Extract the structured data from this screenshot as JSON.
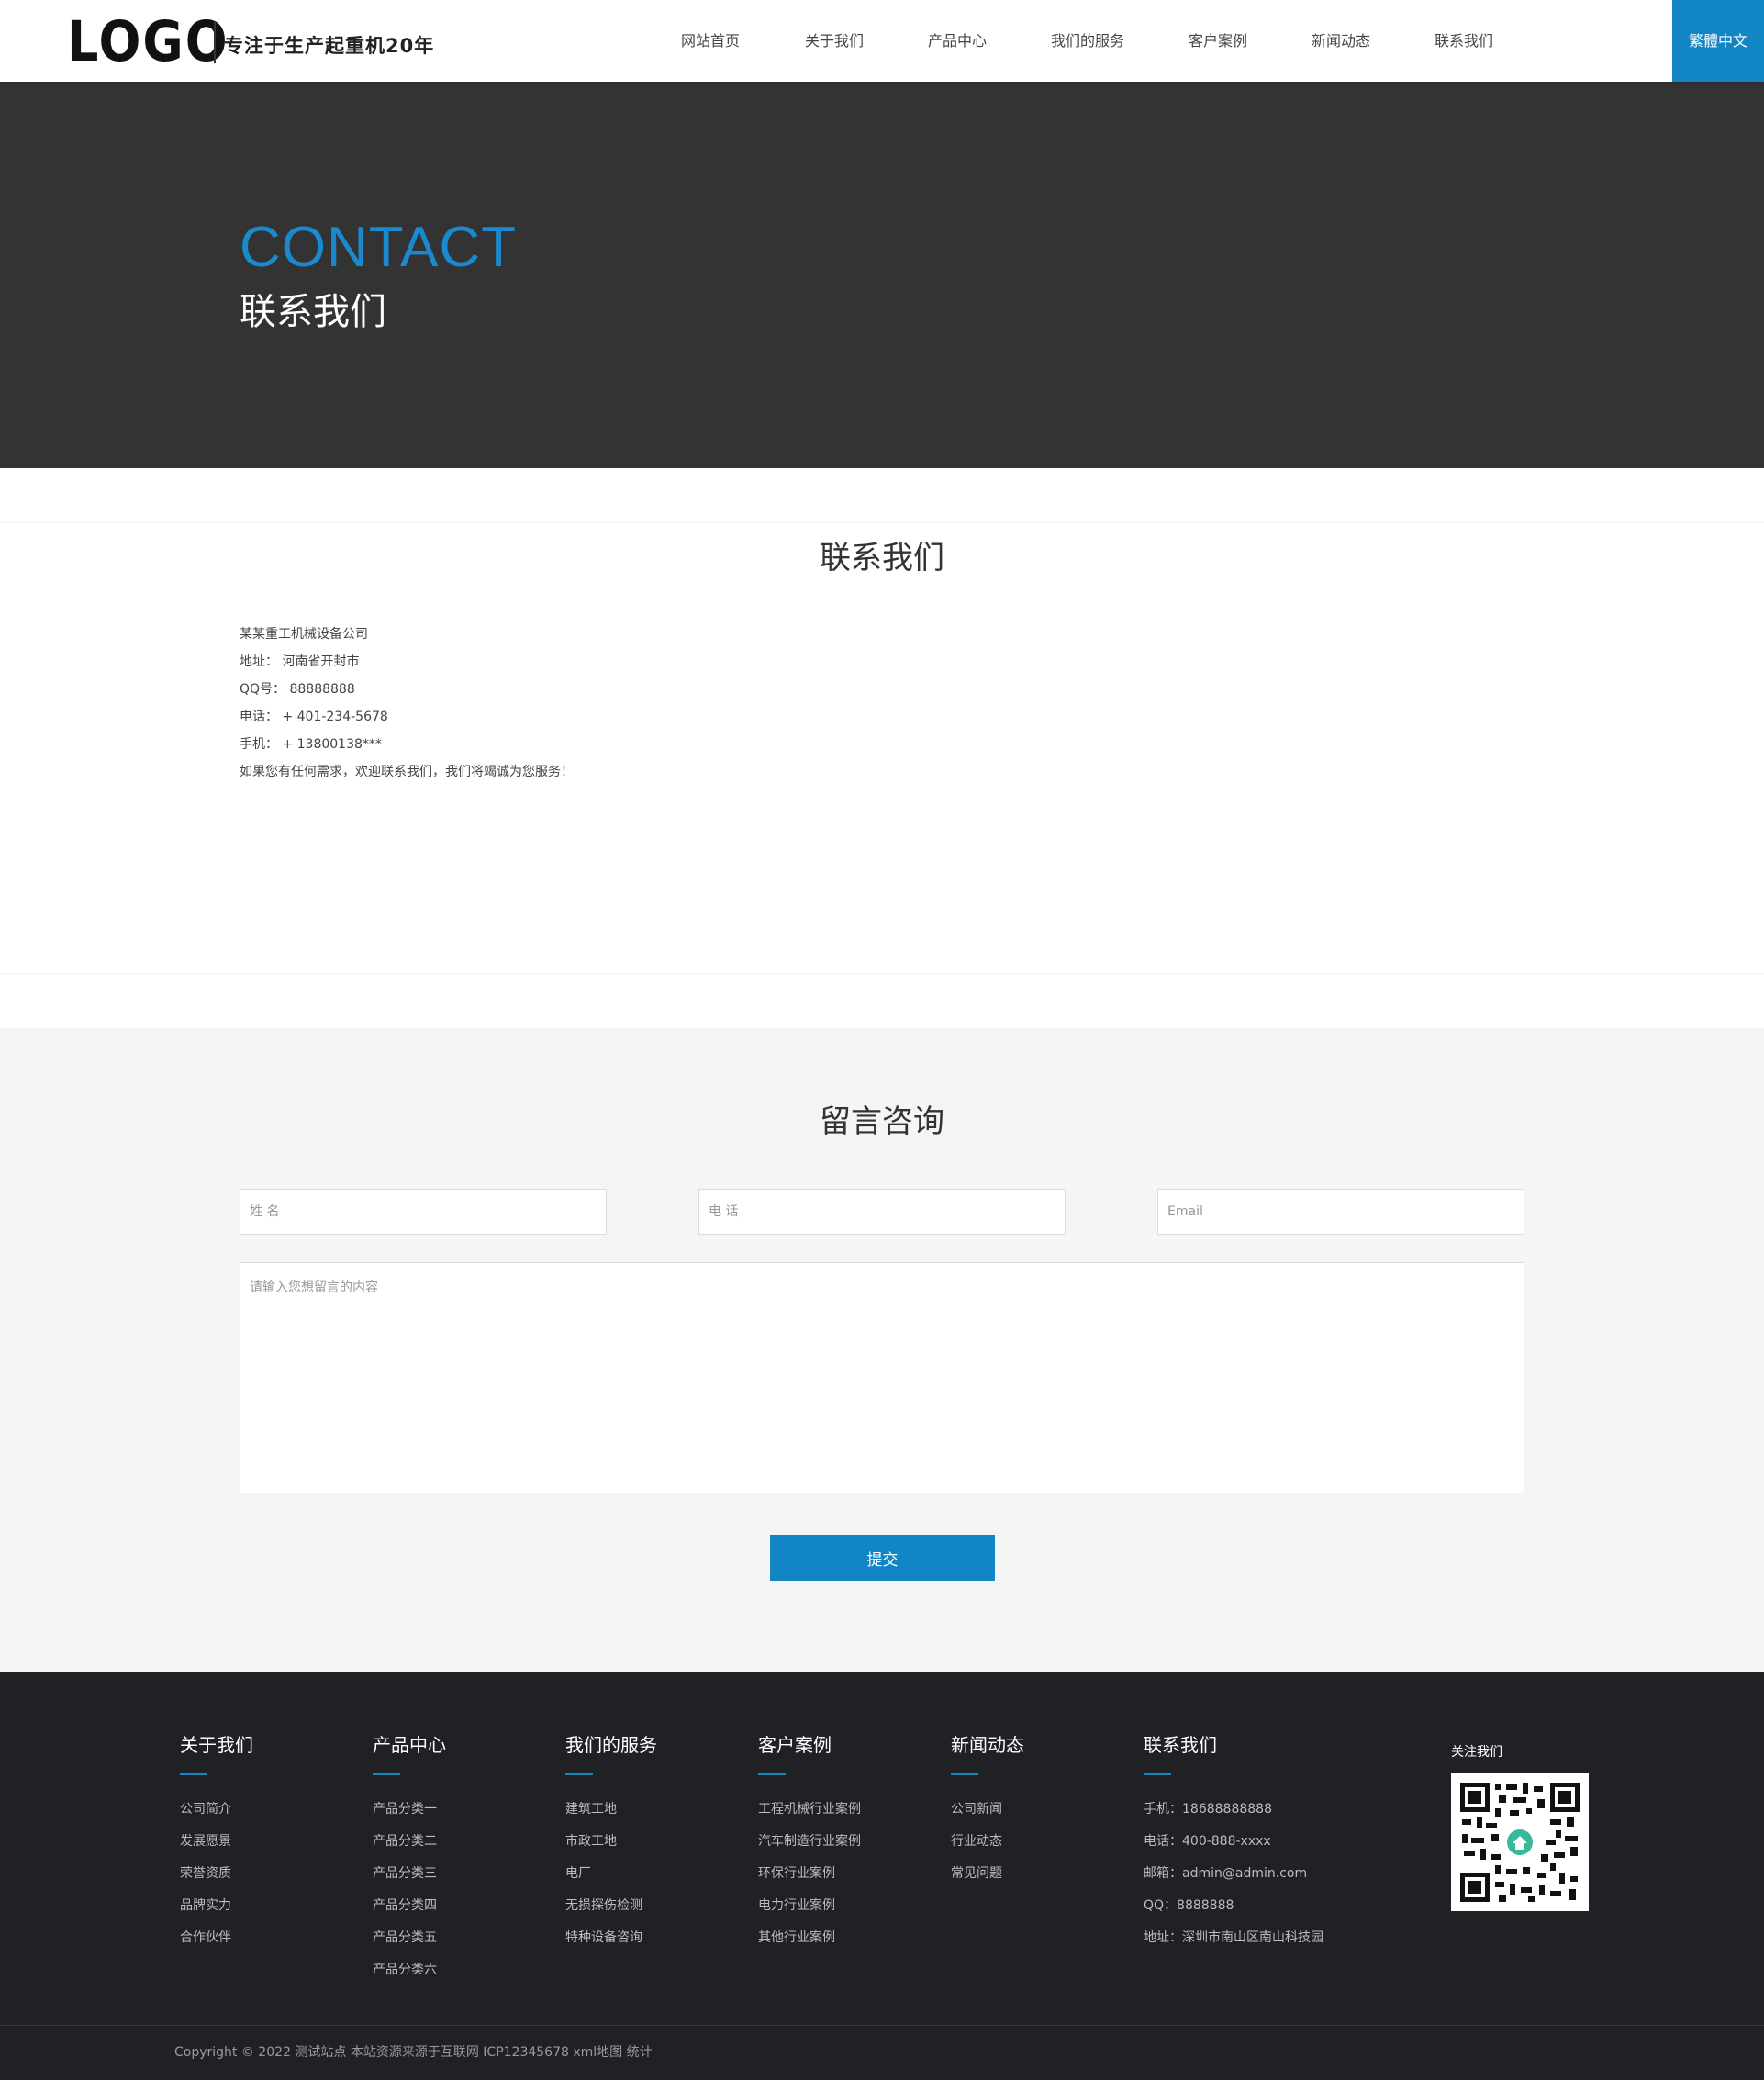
{
  "header": {
    "logo_text": "LOGO",
    "slogan": "专注于生产起重机20年",
    "nav": [
      "网站首页",
      "关于我们",
      "产品中心",
      "我们的服务",
      "客户案例",
      "新闻动态",
      "联系我们"
    ],
    "lang": "繁體中文"
  },
  "banner": {
    "en": "CONTACT",
    "cn": "联系我们"
  },
  "contact": {
    "title": "联系我们",
    "lines": [
      "某某重工机械设备公司",
      "地址： 河南省开封市",
      "QQ号： 88888888",
      "电话： + 401-234-5678",
      "手机： + 13800138***",
      "如果您有任何需求，欢迎联系我们，我们将竭诚为您服务！"
    ]
  },
  "message": {
    "title": "留言咨询",
    "name_placeholder": "姓 名",
    "phone_placeholder": "电 话",
    "email_placeholder": "Email",
    "content_placeholder": "请输入您想留言的内容",
    "submit": "提交"
  },
  "footer": {
    "columns": [
      {
        "title": "关于我们",
        "links": [
          "公司简介",
          "发展愿景",
          "荣誉资质",
          "品牌实力",
          "合作伙伴"
        ]
      },
      {
        "title": "产品中心",
        "links": [
          "产品分类一",
          "产品分类二",
          "产品分类三",
          "产品分类四",
          "产品分类五",
          "产品分类六"
        ]
      },
      {
        "title": "我们的服务",
        "links": [
          "建筑工地",
          "市政工地",
          "电厂",
          "无损探伤检测",
          "特种设备咨询"
        ]
      },
      {
        "title": "客户案例",
        "links": [
          "工程机械行业案例",
          "汽车制造行业案例",
          "环保行业案例",
          "电力行业案例",
          "其他行业案例"
        ]
      },
      {
        "title": "新闻动态",
        "links": [
          "公司新闻",
          "行业动态",
          "常见问题"
        ]
      }
    ],
    "contact": {
      "title": "联系我们",
      "lines": [
        "手机：18688888888",
        "电话：400-888-xxxx",
        "邮箱：admin@admin.com",
        "QQ：8888888",
        "地址：深圳市南山区南山科技园"
      ]
    },
    "qr_title": "关注我们",
    "copyright": "Copyright © 2022 测试站点 本站资源来源于互联网  ICP12345678 xml地图 统计"
  },
  "colors": {
    "accent": "#1285c4",
    "banner_bg": "#333333",
    "footer_bg": "#1f2125"
  },
  "icons": {
    "qr": "qr-code-icon",
    "home": "home-icon"
  }
}
